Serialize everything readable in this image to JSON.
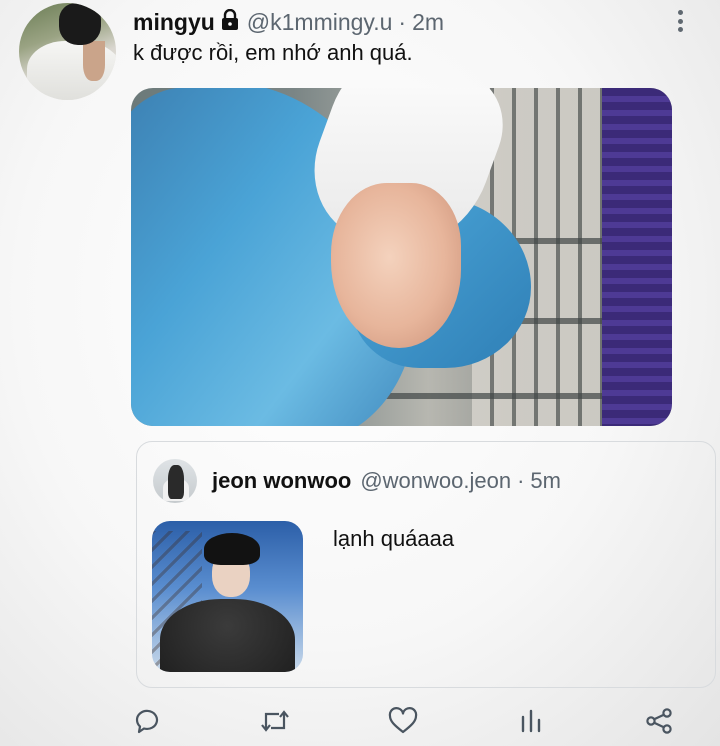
{
  "tweet": {
    "author": {
      "display_name": "mingyu",
      "handle": "@k1mmingy.u",
      "protected_icon": "lock-icon"
    },
    "separator": "·",
    "time": "2m",
    "text": "k được rồi, em nhớ anh quá."
  },
  "quote": {
    "author": {
      "display_name": "jeon wonwoo",
      "handle": "@wonwoo.jeon"
    },
    "separator": "·",
    "time": "5m",
    "text": "lạnh quáaaa"
  },
  "actions": [
    {
      "name": "reply",
      "icon": "reply-icon"
    },
    {
      "name": "retweet",
      "icon": "retweet-icon"
    },
    {
      "name": "like",
      "icon": "heart-icon"
    },
    {
      "name": "analytics",
      "icon": "analytics-icon"
    },
    {
      "name": "share",
      "icon": "share-icon"
    }
  ],
  "colors": {
    "text": "#111111",
    "muted": "#5c6670",
    "icon": "#4a5560",
    "border": "#d8dbde"
  }
}
